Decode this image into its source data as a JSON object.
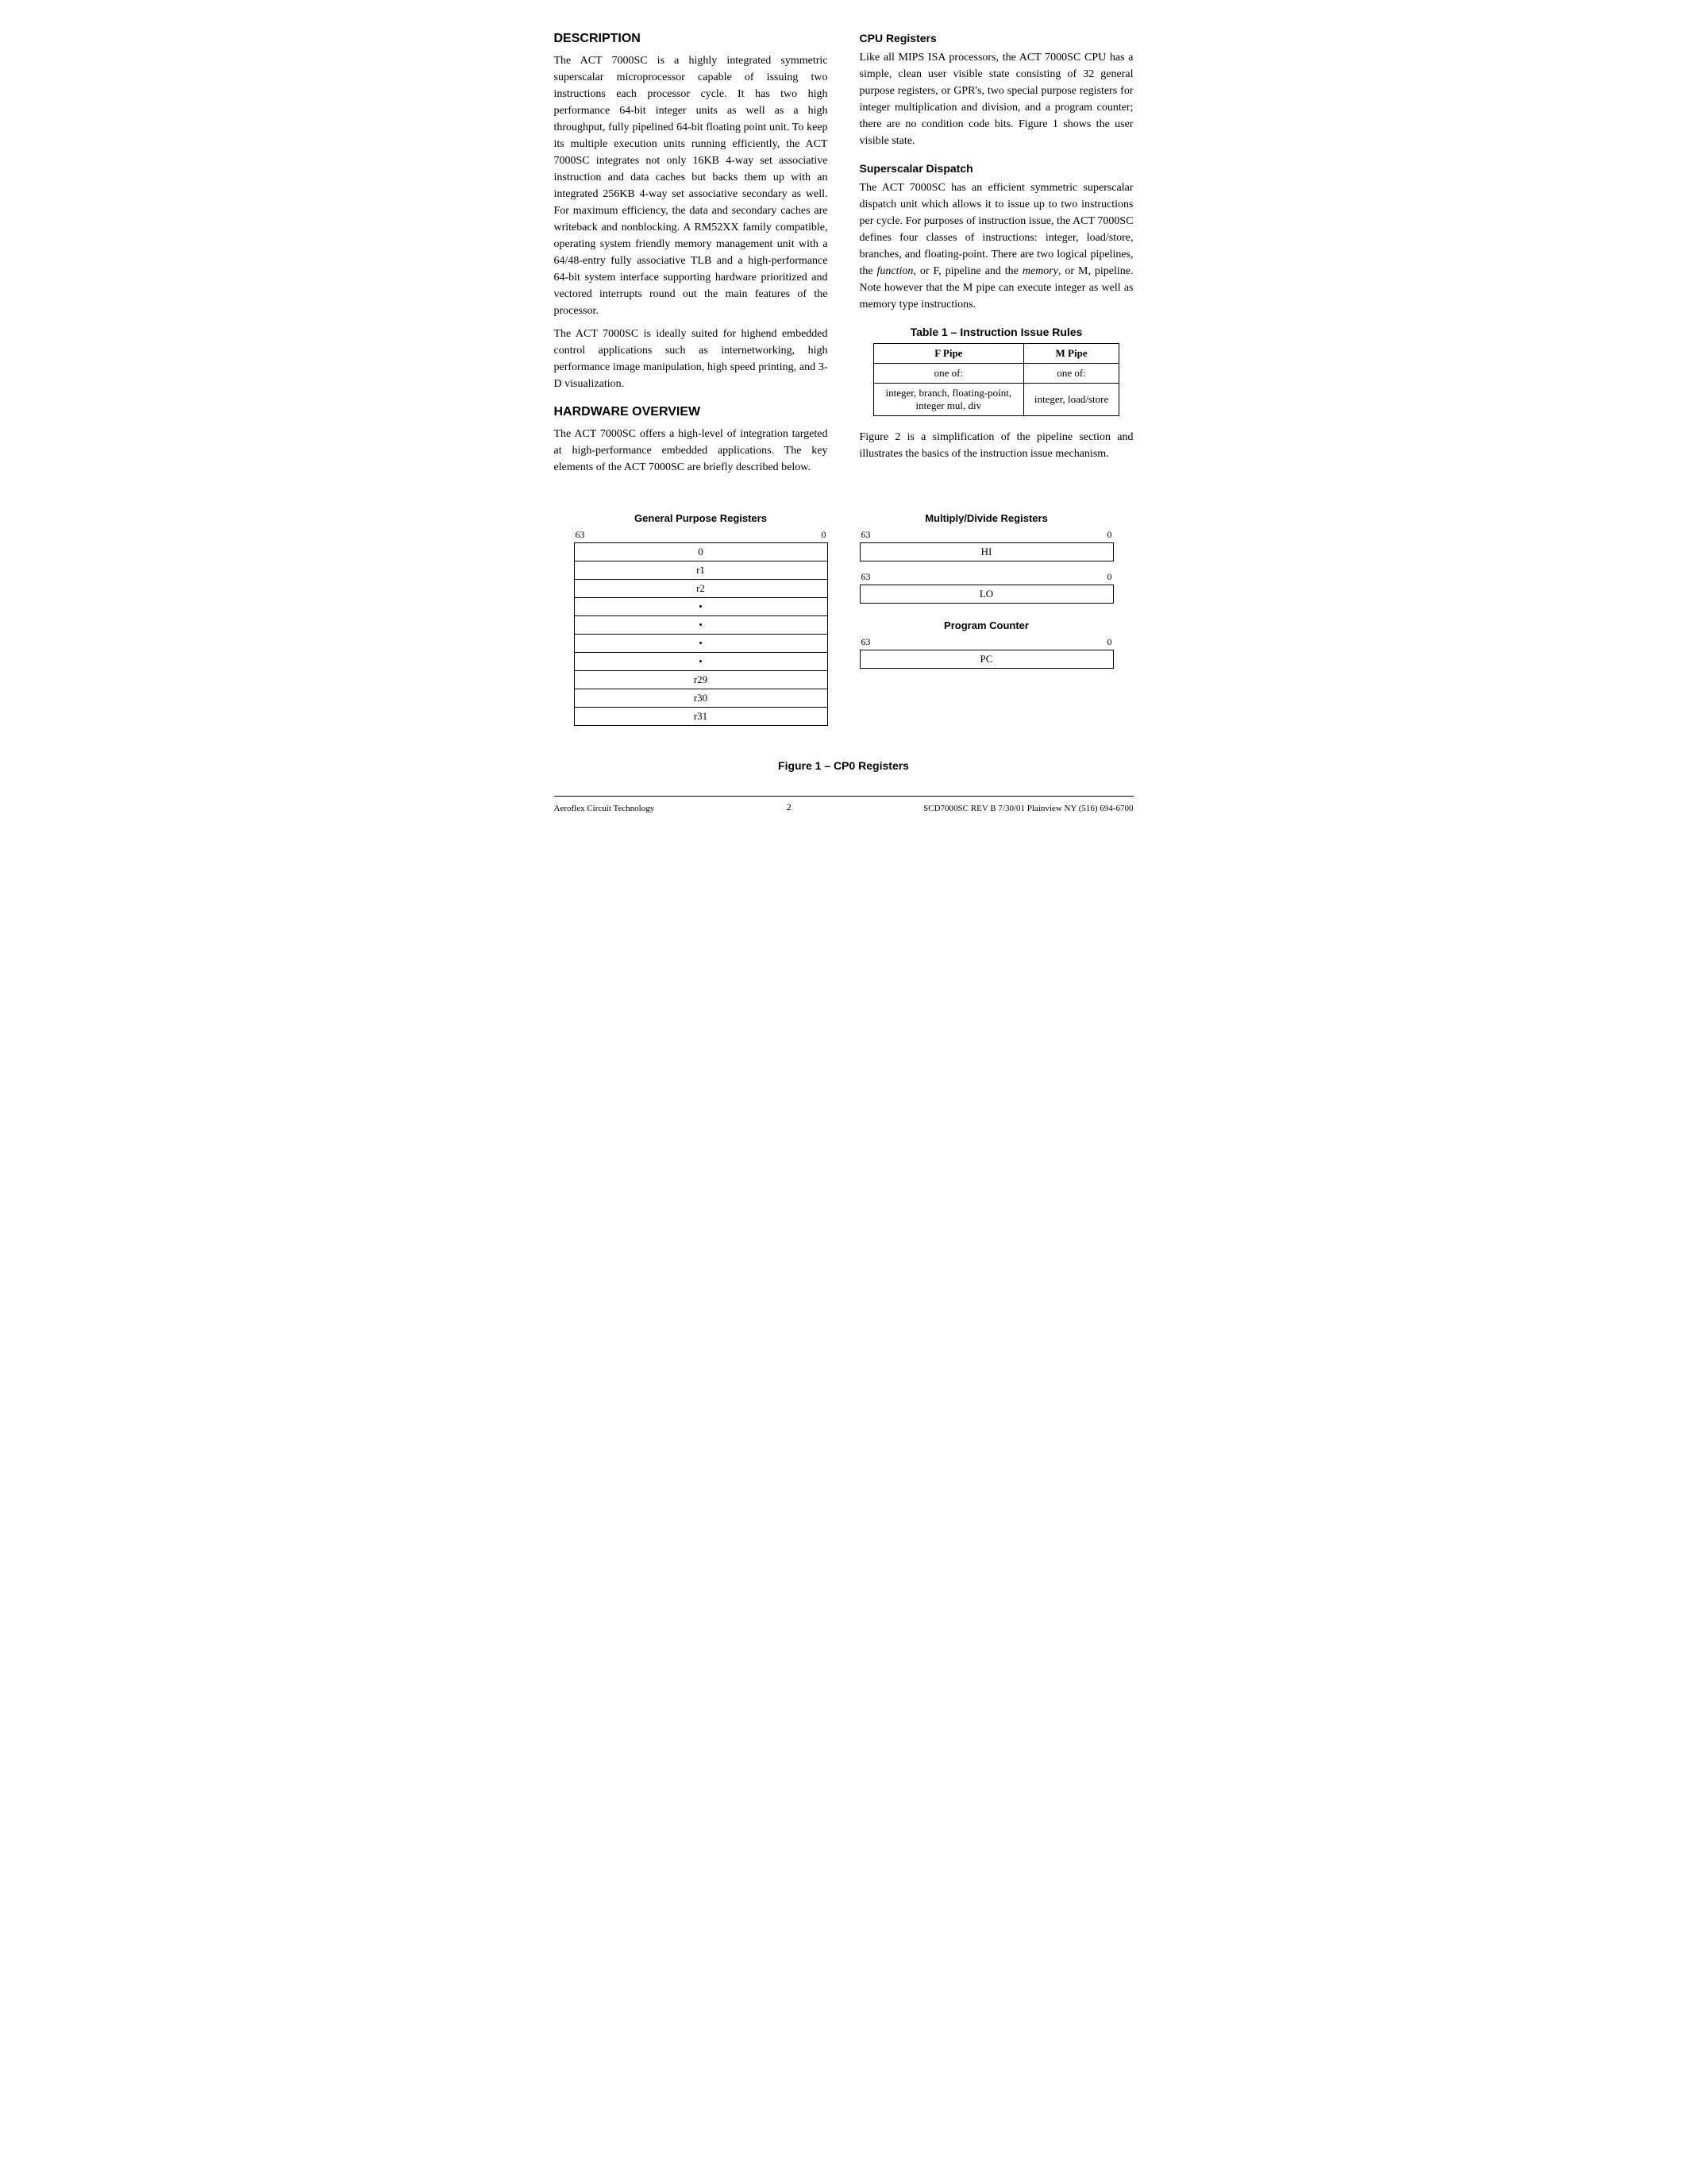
{
  "header": {
    "description_title": "DESCRIPTION",
    "hardware_title": "HARDWARE OVERVIEW"
  },
  "description": {
    "para1": "The ACT 7000SC is a highly integrated symmetric superscalar microprocessor capable of issuing two instructions each processor cycle. It has two high performance 64-bit integer units as well as a high throughput, fully pipelined 64-bit floating point unit. To keep its multiple execution units running efficiently, the ACT 7000SC integrates not only 16KB 4-way set associative instruction and data caches but backs them up with an integrated 256KB 4-way set associative secondary as well. For maximum efficiency, the data and secondary caches are writeback and nonblocking. A RM52XX family compatible, operating system friendly memory management unit with a 64/48-entry fully associative TLB and a high-performance 64-bit system interface supporting hardware prioritized and vectored interrupts round out the main features of the processor.",
    "para2": "The ACT 7000SC is ideally suited for highend embedded control applications such as internetworking, high performance image manipulation, high speed printing, and 3-D visualization."
  },
  "hardware": {
    "para1": "The ACT 7000SC offers a high-level of integration targeted at high-performance embedded applications. The key elements of the ACT 7000SC are briefly described below."
  },
  "cpu_registers": {
    "title": "CPU Registers",
    "para1": "Like all MIPS ISA processors, the ACT 7000SC CPU has a simple, clean user visible state consisting of 32 general purpose registers, or GPR's, two special purpose registers for integer multiplication and division, and a program counter; there are no condition code bits. Figure 1 shows the user visible state."
  },
  "superscalar": {
    "title": "Superscalar Dispatch",
    "para1": "The ACT 7000SC has an efficient symmetric superscalar dispatch unit which allows it to issue up to two instructions per cycle. For purposes of instruction issue, the ACT 7000SC defines four classes of instructions: integer, load/store, branches, and floating-point. There are two logical pipelines, the function, or F, pipeline and the memory, or M, pipeline. Note however that the M pipe can execute integer as well as memory type instructions."
  },
  "table1": {
    "title": "Table 1 – Instruction Issue Rules",
    "col1": "F Pipe",
    "col2": "M Pipe",
    "row1col1": "one of:",
    "row1col2": "one of:",
    "row2col1": "integer, branch, floating-point,\ninteger mul, div",
    "row2col2": "integer, load/store"
  },
  "figure_para": "Figure 2 is a simplification of the pipeline section and illustrates the basics of the instruction issue mechanism.",
  "gpr_diagram": {
    "title": "General Purpose Registers",
    "bit_high": "63",
    "bit_low": "0",
    "rows": [
      "0",
      "r1",
      "r2",
      "•",
      "•",
      "•",
      "•",
      "r29",
      "r30",
      "r31"
    ]
  },
  "md_diagram": {
    "title": "Multiply/Divide Registers",
    "hi": {
      "bit_high": "63",
      "bit_low": "0",
      "label": "HI"
    },
    "lo": {
      "bit_high": "63",
      "bit_low": "0",
      "label": "LO"
    }
  },
  "pc_diagram": {
    "title": "Program Counter",
    "bit_high": "63",
    "bit_low": "0",
    "label": "PC"
  },
  "figure_caption": "Figure 1 – CP0 Registers",
  "footer": {
    "left": "Aeroflex Circuit Technology",
    "center": "2",
    "right": "SCD7000SC REV B  7/30/01  Plainview NY (516) 694-6700"
  }
}
